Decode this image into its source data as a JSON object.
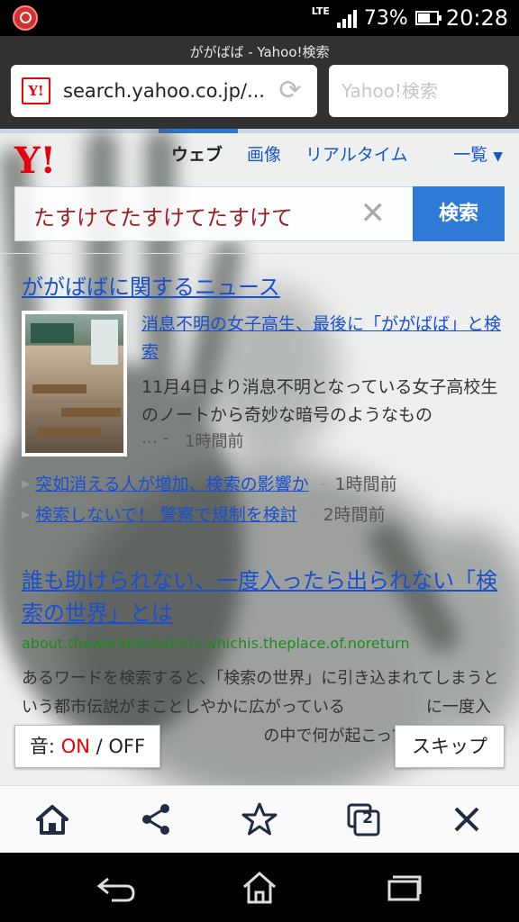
{
  "status_bar": {
    "network": "LTE",
    "battery_percent": "73%",
    "time": "20:28"
  },
  "browser": {
    "page_title": "ががばば - Yahoo!検索",
    "url": "search.yahoo.co.jp/...",
    "search_placeholder": "Yahoo!検索",
    "favicon_text": "Y!"
  },
  "yahoo": {
    "logo": "Y!",
    "tabs": [
      "ウェブ",
      "画像",
      "リアルタイム"
    ],
    "more_label": "一覧",
    "query": "たすけてたすけてたすけて",
    "search_button": "検索"
  },
  "news": {
    "heading": "ががばばに関するニュース",
    "main_link": "消息不明の女子高生、最後に「ががばば」と検索",
    "snippet": "11月4日より消息不明となっている女子高校生のノートから奇妙な暗号のようなもの",
    "ellipsis": "… -",
    "time": "1時間前",
    "sub_items": [
      {
        "title": "突如消える人が増加、検索の影響か",
        "time": "1時間前"
      },
      {
        "title": "検索しないで！ 警察で規制を検討",
        "time": "2時間前"
      }
    ]
  },
  "result": {
    "title": "誰も助けられない、一度入ったら出られない「検索の世界」とは",
    "url": "about.theworldofsearchs.whichis.theplace.of.noreturn",
    "snippet": "あるワードを検索すると、「検索の世界」に引き込まれてしまうという都市伝説がまことしやかに広がっている　　　　　に一度入ってしまうと、二　　　　　　　の中で何が起こっているのか未"
  },
  "overlay": {
    "sound_label": "音:",
    "sound_on": "ON",
    "sound_sep": "/",
    "sound_off": "OFF",
    "skip_label": "スキップ"
  },
  "toolbar": {
    "tab_count": "2"
  }
}
